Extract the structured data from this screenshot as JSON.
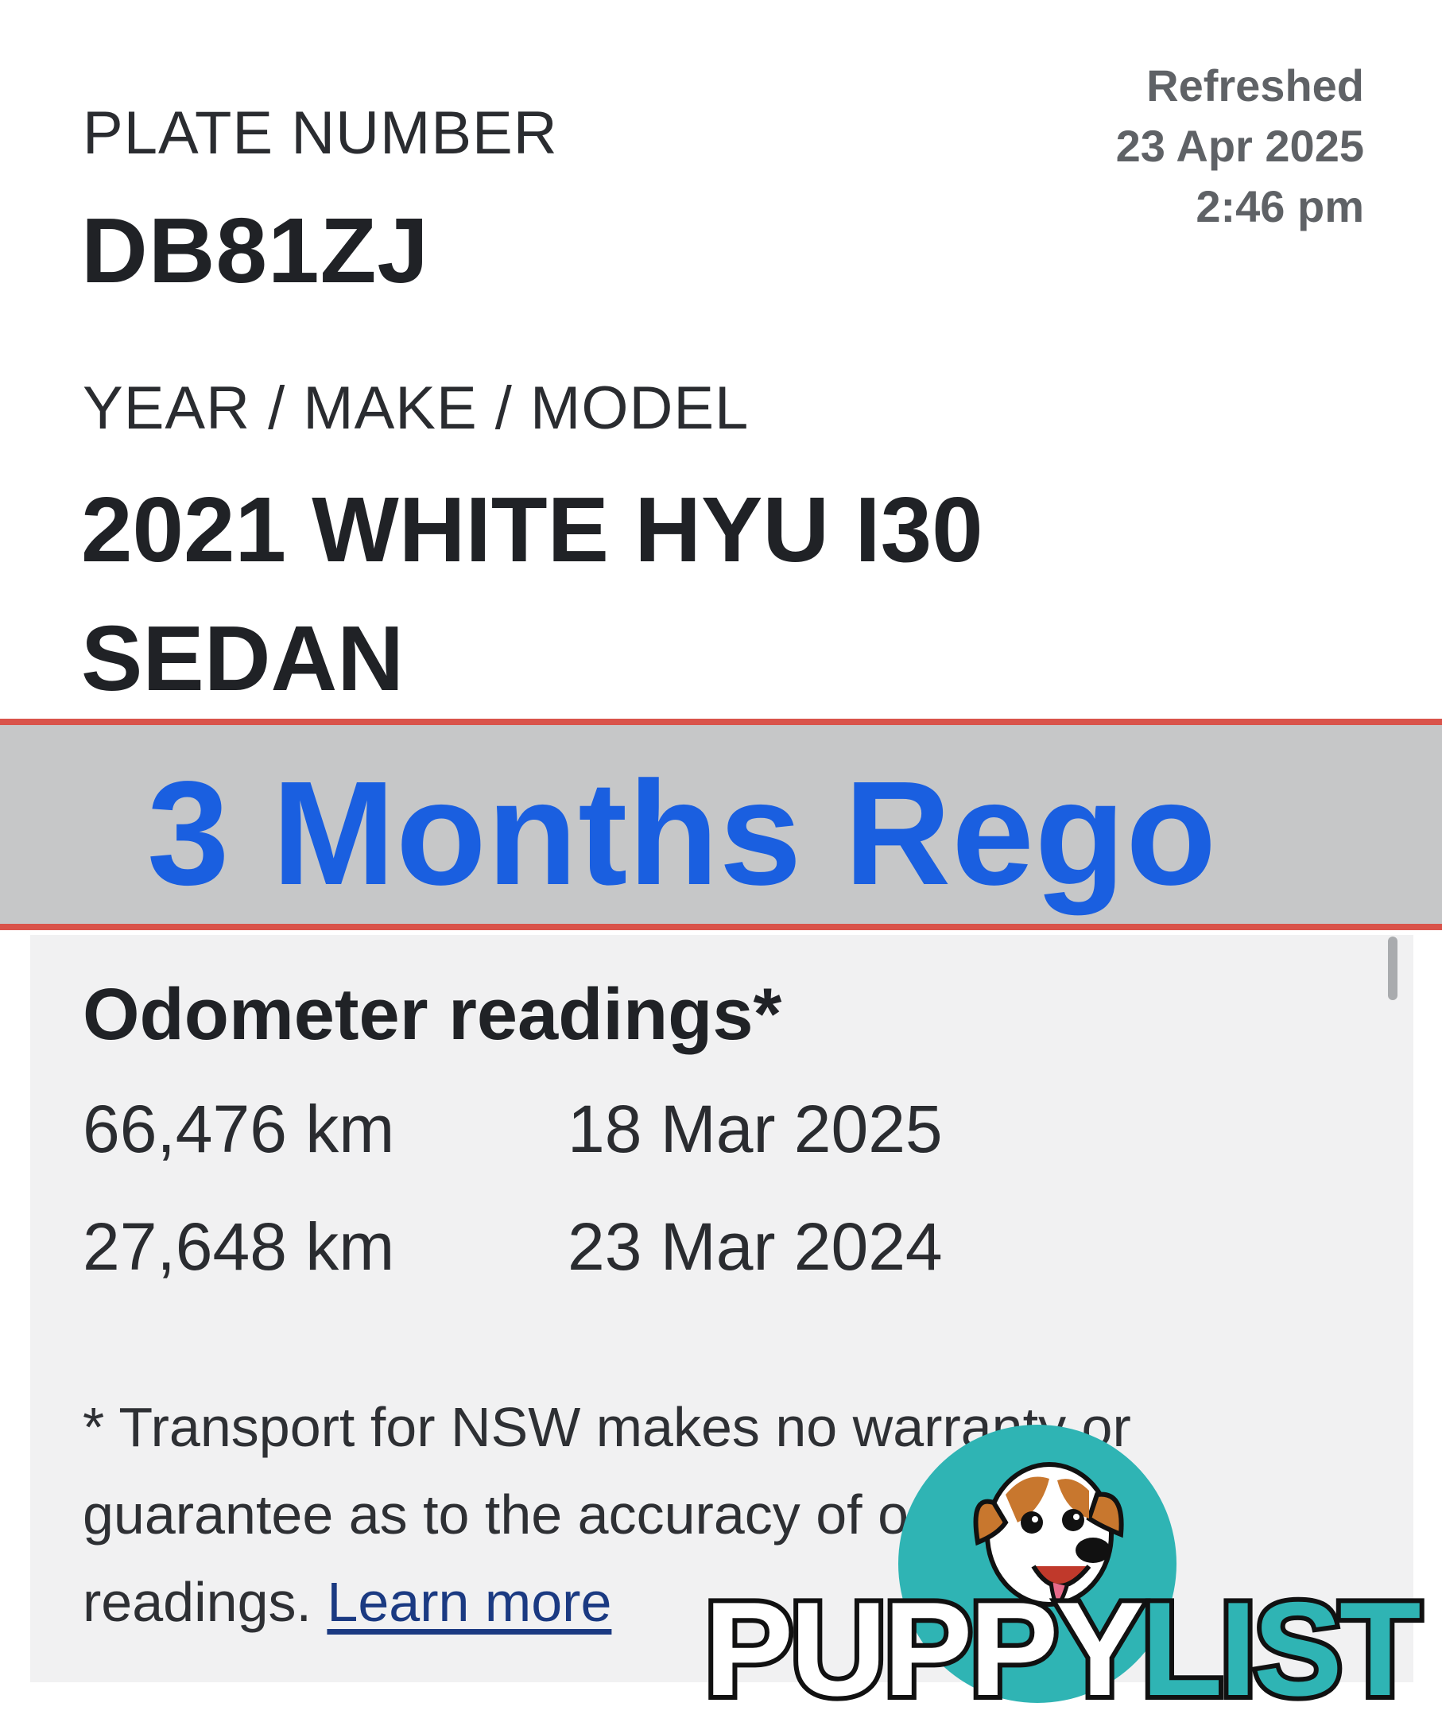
{
  "plate": {
    "label": "PLATE NUMBER",
    "value": "DB81ZJ"
  },
  "refreshed": {
    "label": "Refreshed",
    "date": "23 Apr 2025",
    "time": "2:46 pm"
  },
  "vehicle": {
    "label": "YEAR / MAKE / MODEL",
    "line1": "2021 WHITE HYU I30",
    "line2": "SEDAN"
  },
  "banner": {
    "text": "3 Months Rego",
    "text_color": "#1a5fe0",
    "background": "#c6c7c8",
    "border_color": "#d9534a"
  },
  "odometer": {
    "title": "Odometer readings*",
    "readings": [
      {
        "km": "66,476 km",
        "date": "18 Mar 2025"
      },
      {
        "km": "27,648 km",
        "date": "23 Mar 2024"
      }
    ]
  },
  "disclaimer": {
    "text": "* Transport for NSW makes no warranty or guarantee as to the accuracy of odometer readings.",
    "link": "Learn more",
    "link_color": "#1b3a82"
  },
  "watermark": {
    "word_white": "PUPPY",
    "word_teal": "LIST",
    "mascot": "dog-mascot-icon",
    "teal": "#2fb4b4"
  }
}
